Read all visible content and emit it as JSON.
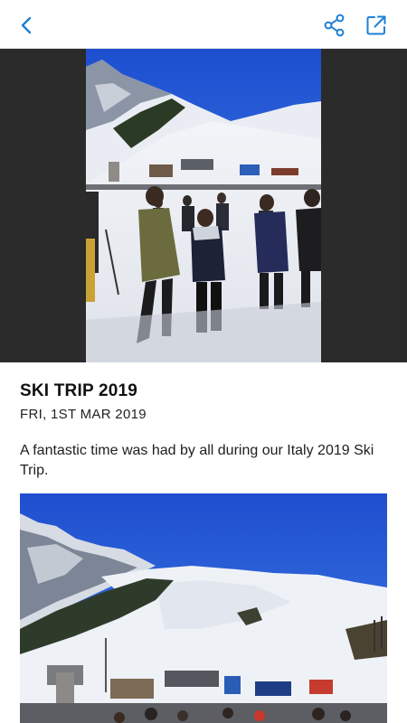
{
  "header": {
    "back_icon": "chevron-left-icon",
    "share_icon": "share-icon",
    "open_external_icon": "external-link-icon",
    "accent_color": "#1f7fd6"
  },
  "hero_image": {
    "subject": "ski-slope-crowd-photo"
  },
  "article": {
    "title": "SKI TRIP 2019",
    "date": "FRI, 1ST MAR 2019",
    "body": "A fantastic time was had by all during our Italy 2019 Ski Trip."
  },
  "inline_image": {
    "subject": "ski-resort-panorama-photo"
  }
}
